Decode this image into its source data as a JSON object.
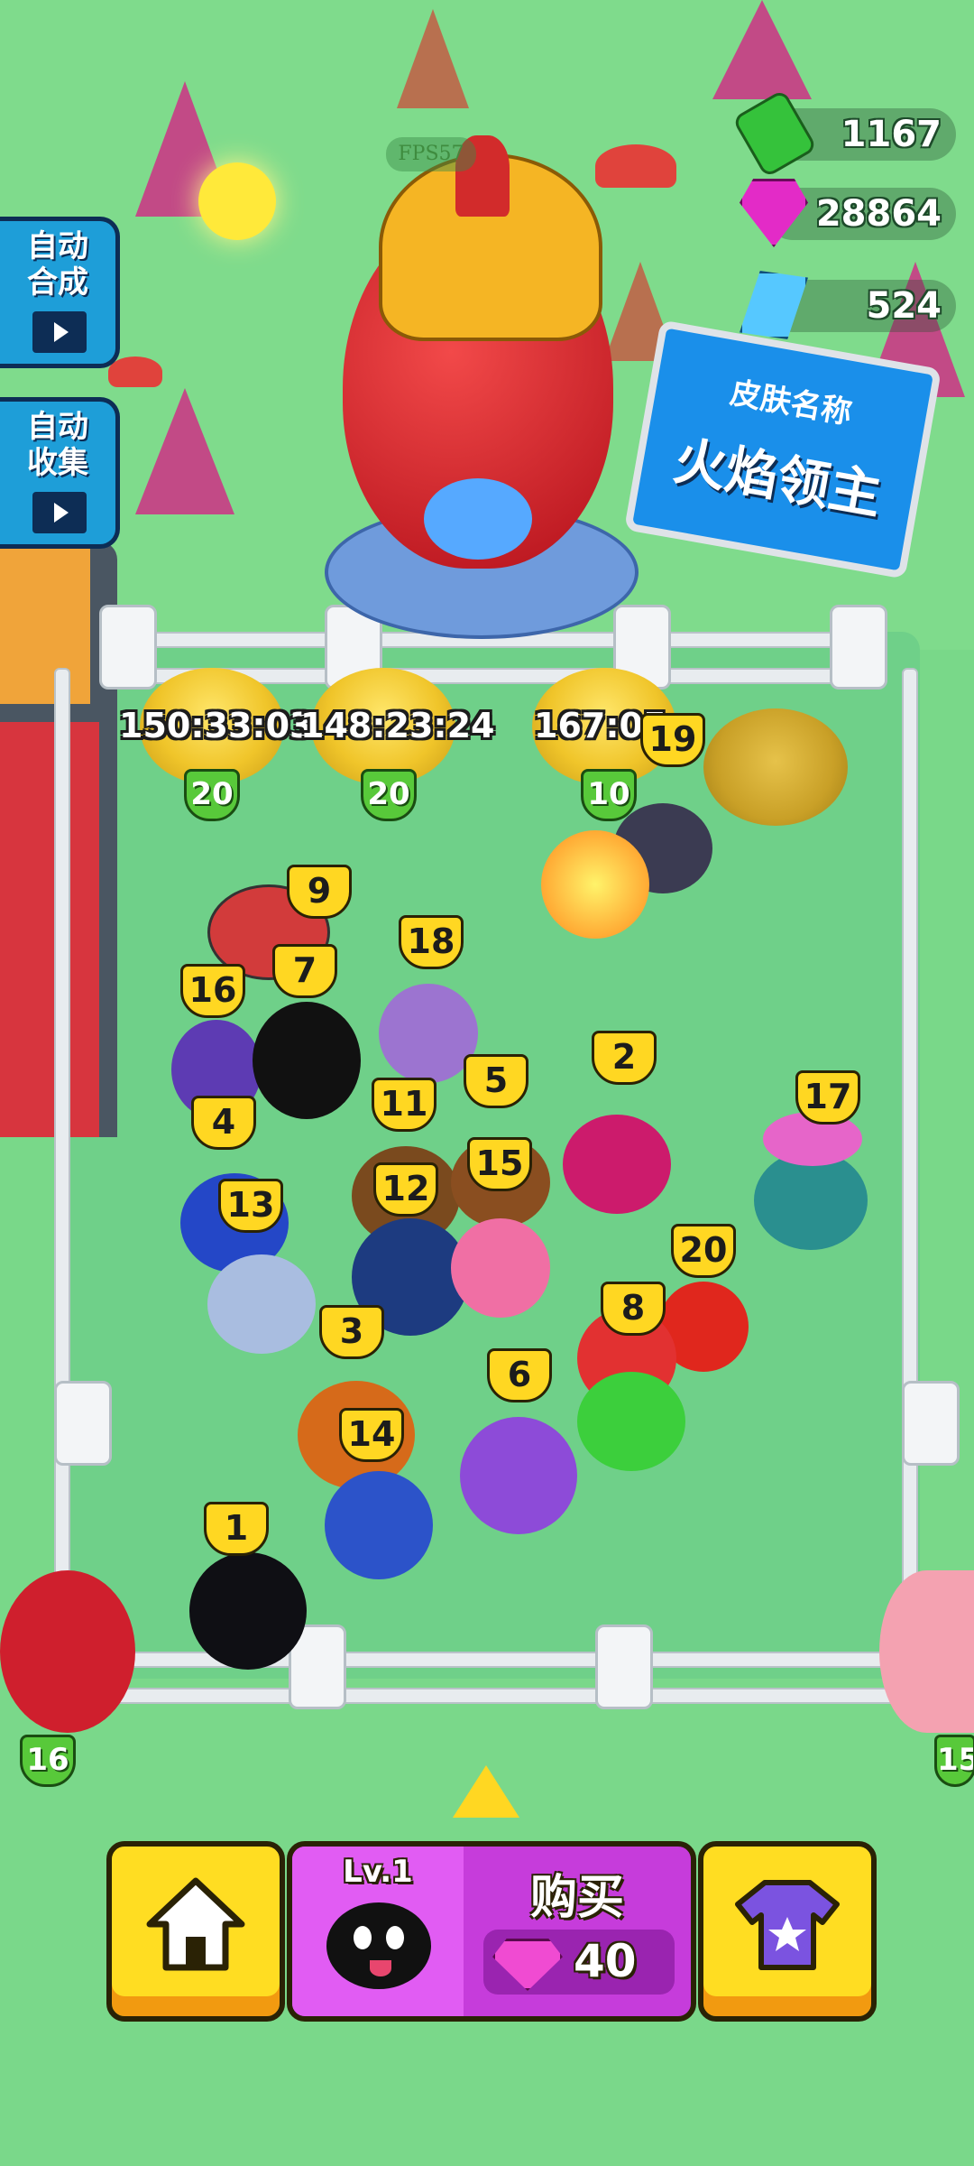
{
  "hud": {
    "fps": "FPS57",
    "cash": "1167",
    "gems": "28864",
    "crystals": "524"
  },
  "side_buttons": {
    "auto_merge": "自动\n合成",
    "auto_collect": "自动\n收集"
  },
  "sign": {
    "title": "皮肤名称",
    "name": "火焰领主"
  },
  "nests": [
    {
      "timer": "150:33:03",
      "level": "20"
    },
    {
      "timer": "148:23:24",
      "level": "20"
    },
    {
      "timer": "167:05",
      "level": "10"
    }
  ],
  "creatures": [
    {
      "level": "19"
    },
    {
      "level": "9"
    },
    {
      "level": "18"
    },
    {
      "level": "7"
    },
    {
      "level": "16"
    },
    {
      "level": "2"
    },
    {
      "level": "5"
    },
    {
      "level": "11"
    },
    {
      "level": "4"
    },
    {
      "level": "17"
    },
    {
      "level": "15"
    },
    {
      "level": "12"
    },
    {
      "level": "13"
    },
    {
      "level": "20"
    },
    {
      "level": "8"
    },
    {
      "level": "3"
    },
    {
      "level": "6"
    },
    {
      "level": "14"
    },
    {
      "level": "1"
    }
  ],
  "edge_badges": {
    "left": "16",
    "right": "15"
  },
  "bottom_bar": {
    "buy_level": "Lv.1",
    "buy_label": "购买",
    "buy_price": "40"
  },
  "colors": {
    "grass": "#7fdb8c",
    "accent_yellow": "#ffdd22",
    "buy_purple": "#c63cdb",
    "side_button_blue": "#1e9ed8"
  }
}
